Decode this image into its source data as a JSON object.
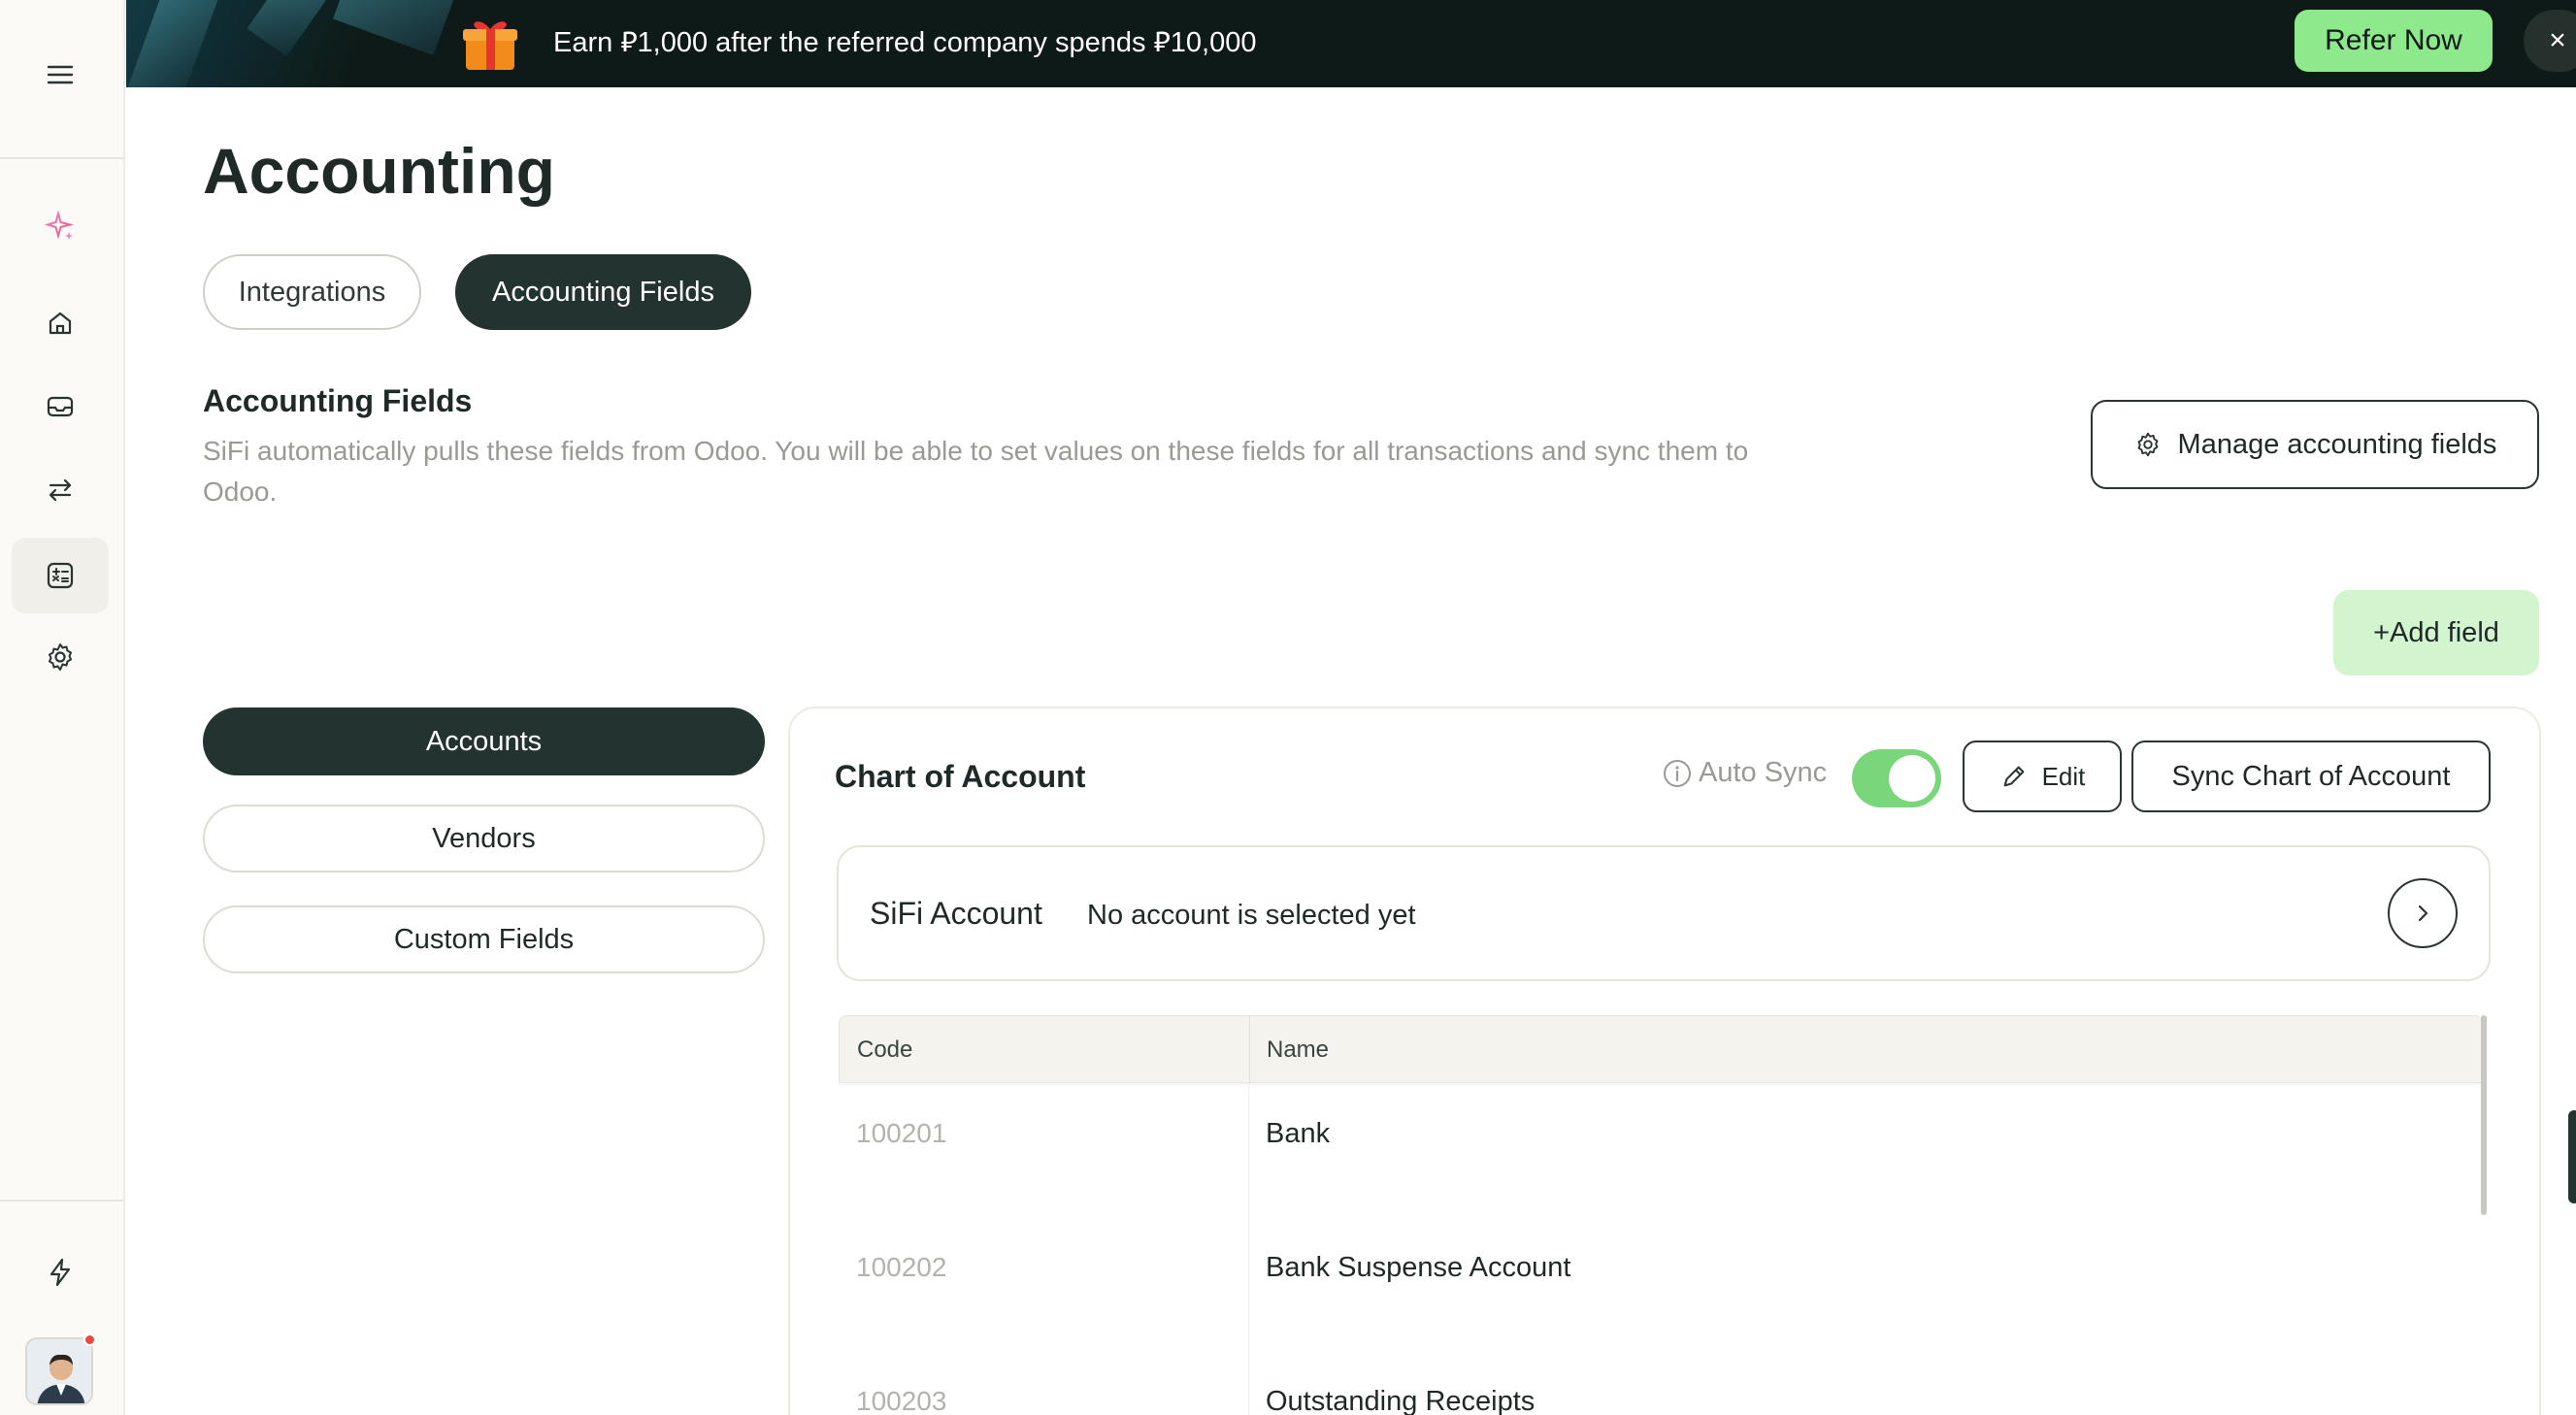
{
  "banner": {
    "text": "Earn ⃁1,000 after the referred company spends ⃁10,000",
    "refer_label": "Refer Now",
    "close_label": "×"
  },
  "sidebar": {
    "items": [
      {
        "icon": "menu-icon"
      },
      {
        "icon": "sparkle-icon"
      },
      {
        "icon": "home-icon"
      },
      {
        "icon": "inbox-icon"
      },
      {
        "icon": "transfer-icon"
      },
      {
        "icon": "calculator-icon",
        "active": true
      },
      {
        "icon": "gear-icon"
      },
      {
        "icon": "bolt-icon"
      }
    ]
  },
  "page": {
    "title": "Accounting",
    "tabs": [
      {
        "label": "Integrations",
        "active": false
      },
      {
        "label": "Accounting Fields",
        "active": true
      }
    ]
  },
  "section": {
    "title": "Accounting Fields",
    "description": "SiFi automatically pulls these fields from Odoo. You will be able to set values on these fields for all transactions and sync them to Odoo.",
    "manage_label": "Manage accounting fields",
    "add_field_label": "+Add field"
  },
  "categories": [
    {
      "label": "Accounts",
      "active": true
    },
    {
      "label": "Vendors",
      "active": false
    },
    {
      "label": "Custom Fields",
      "active": false
    }
  ],
  "panel": {
    "title": "Chart of Account",
    "auto_sync_label": "Auto Sync",
    "auto_sync_on": true,
    "edit_label": "Edit",
    "sync_label": "Sync Chart of Account",
    "sifi_label": "SiFi Account",
    "sifi_value": "No account is selected yet"
  },
  "table": {
    "columns": [
      "Code",
      "Name"
    ],
    "rows": [
      {
        "code": "100201",
        "name": "Bank"
      },
      {
        "code": "100202",
        "name": "Bank Suspense Account"
      },
      {
        "code": "100203",
        "name": "Outstanding Receipts"
      }
    ]
  },
  "colors": {
    "accent_dark": "#23332f",
    "accent_green": "#8ee88c",
    "toggle_green": "#79d67a"
  }
}
